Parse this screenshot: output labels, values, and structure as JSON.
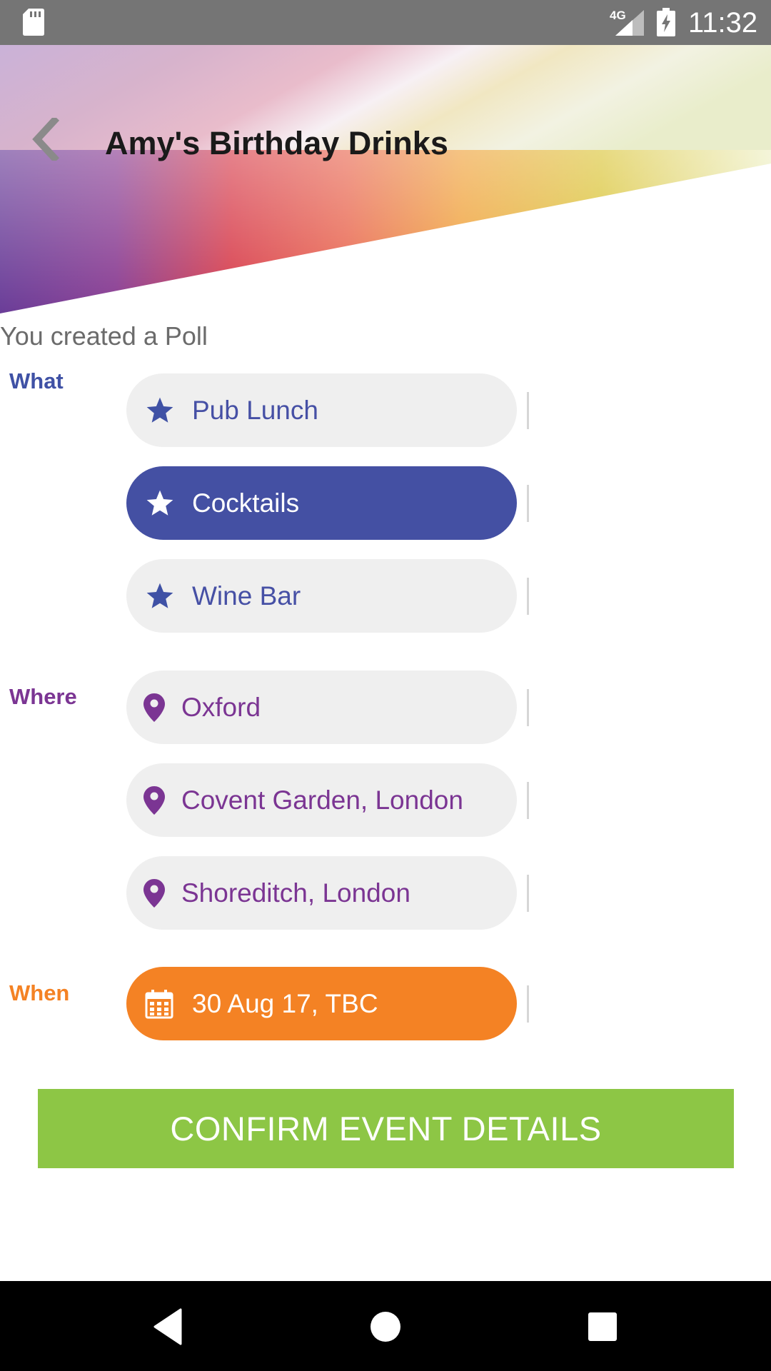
{
  "status_bar": {
    "network": "4G",
    "time": "11:32"
  },
  "header": {
    "title": "Amy's Birthday Drinks"
  },
  "poll": {
    "caption": "You created a Poll",
    "what": {
      "label": "What",
      "label_color": "#3f51a5",
      "icon": "star-icon",
      "options": [
        {
          "text": "Pub Lunch",
          "selected": false
        },
        {
          "text": "Cocktails",
          "selected": true
        },
        {
          "text": "Wine Bar",
          "selected": false
        }
      ]
    },
    "where": {
      "label": "Where",
      "label_color": "#7b3593",
      "icon": "location-pin-icon",
      "options": [
        {
          "text": "Oxford"
        },
        {
          "text": "Covent Garden, London"
        },
        {
          "text": "Shoreditch, London"
        }
      ]
    },
    "when": {
      "label": "When",
      "label_color": "#f48224",
      "icon": "calendar-icon",
      "options": [
        {
          "text": "30 Aug 17, TBC"
        }
      ]
    }
  },
  "actions": {
    "confirm_label": "CONFIRM EVENT DETAILS",
    "confirm_color": "#8dc645"
  },
  "nav_bar": {
    "back": "nav-back-icon",
    "home": "nav-home-icon",
    "recents": "nav-recents-icon"
  }
}
